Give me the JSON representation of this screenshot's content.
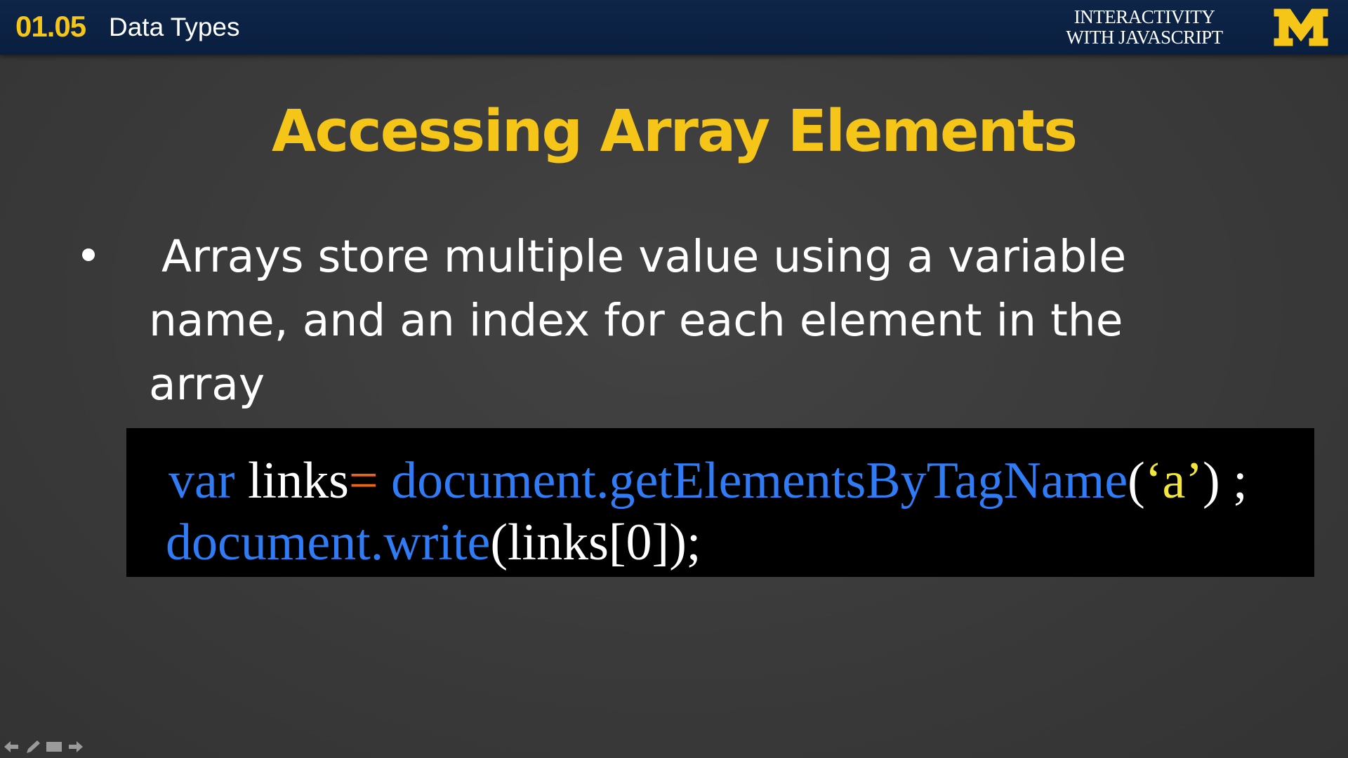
{
  "header": {
    "lesson_number": "01.05",
    "lesson_title": "Data Types",
    "course_line1": "INTERACTIVITY",
    "course_line2": "WITH JAVASCRIPT",
    "logo_icon": "university-m-logo",
    "colors": {
      "bar": "#0a1f3f",
      "accent": "#f5c518"
    }
  },
  "slide": {
    "title": "Accessing Array Elements",
    "bullet": {
      "line1": "Arrays store multiple value using a variable",
      "line2": "name, and an index for each element in the",
      "line3": "array"
    },
    "code": {
      "line1": {
        "kw_var": "var",
        "ident": " links",
        "op": "=",
        "call": " document.getElementsByTagName",
        "open": "(",
        "str": "‘a’",
        "close": ") ;"
      },
      "line2": {
        "call": "document.write",
        "args": "(links[0]);"
      },
      "colors": {
        "background": "#000000",
        "keyword": "#2f7cf6",
        "operator": "#e8651a",
        "string": "#f2e63a",
        "text": "#ffffff"
      }
    },
    "background": "#3a3a3a"
  },
  "nav": {
    "icons": [
      "arrow-left-icon",
      "pen-icon",
      "screen-icon",
      "arrow-right-icon"
    ]
  }
}
